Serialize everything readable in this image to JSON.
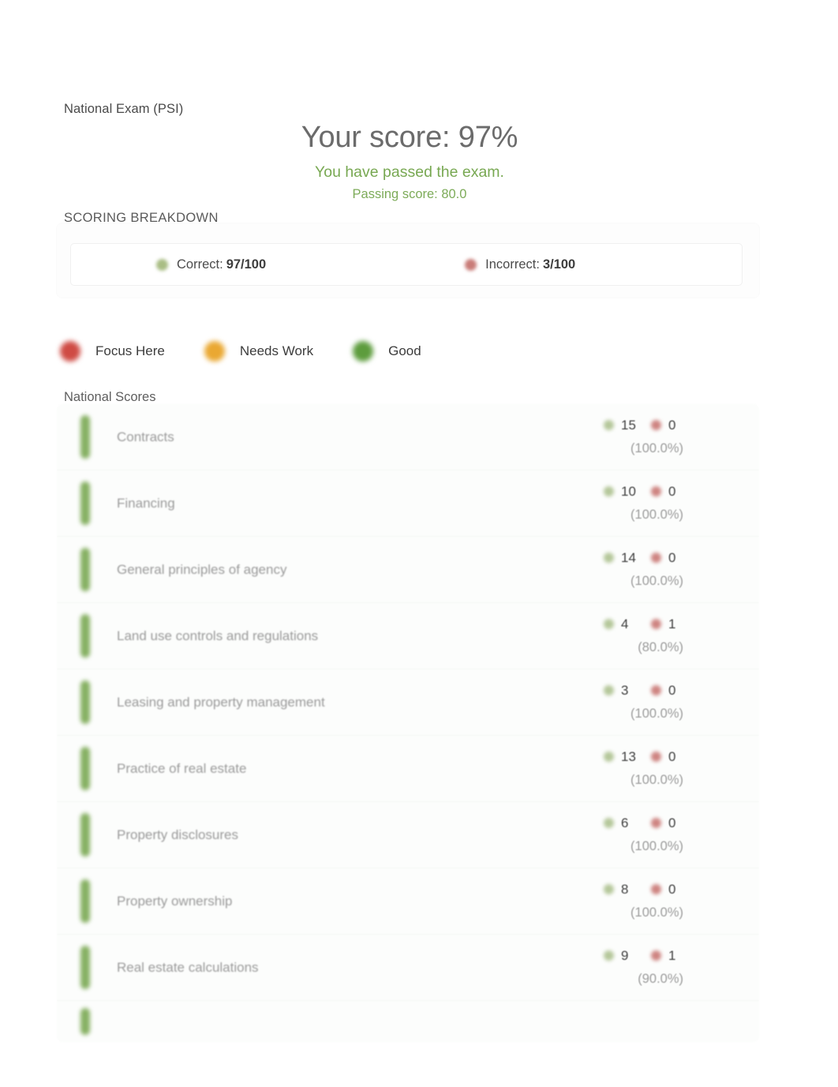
{
  "header": {
    "exam_title": "National Exam (PSI)",
    "score_headline": "Your score: 97%",
    "pass_message": "You have passed the exam.",
    "passing_score": "Passing score: 80.0"
  },
  "breakdown": {
    "label": "SCORING BREAKDOWN",
    "correct_label": "Correct:",
    "correct_value": "97/100",
    "incorrect_label": "Incorrect:",
    "incorrect_value": "3/100"
  },
  "legend": {
    "items": [
      {
        "label": "Focus Here",
        "color": "#cf4b44"
      },
      {
        "label": "Needs Work",
        "color": "#eaa832"
      },
      {
        "label": "Good",
        "color": "#5d9c3d"
      }
    ]
  },
  "scores_section": {
    "label": "National Scores",
    "rows": [
      {
        "category": "Contracts",
        "correct": "15",
        "incorrect": "0",
        "percent": "(100.0%)",
        "status": "good"
      },
      {
        "category": "Financing",
        "correct": "10",
        "incorrect": "0",
        "percent": "(100.0%)",
        "status": "good"
      },
      {
        "category": "General principles of agency",
        "correct": "14",
        "incorrect": "0",
        "percent": "(100.0%)",
        "status": "good"
      },
      {
        "category": "Land use controls and regulations",
        "correct": "4",
        "incorrect": "1",
        "percent": "(80.0%)",
        "status": "good"
      },
      {
        "category": "Leasing and property management",
        "correct": "3",
        "incorrect": "0",
        "percent": "(100.0%)",
        "status": "good"
      },
      {
        "category": "Practice of real estate",
        "correct": "13",
        "incorrect": "0",
        "percent": "(100.0%)",
        "status": "good"
      },
      {
        "category": "Property disclosures",
        "correct": "6",
        "incorrect": "0",
        "percent": "(100.0%)",
        "status": "good"
      },
      {
        "category": "Property ownership",
        "correct": "8",
        "incorrect": "0",
        "percent": "(100.0%)",
        "status": "good"
      },
      {
        "category": "Real estate calculations",
        "correct": "9",
        "incorrect": "1",
        "percent": "(90.0%)",
        "status": "good"
      }
    ],
    "partial_row_visible": true
  },
  "colors": {
    "pass_green": "#78a852",
    "bar_green": "#86b062",
    "focus_red": "#cf4b44",
    "needs_work_orange": "#eaa832",
    "good_green": "#5d9c3d"
  }
}
